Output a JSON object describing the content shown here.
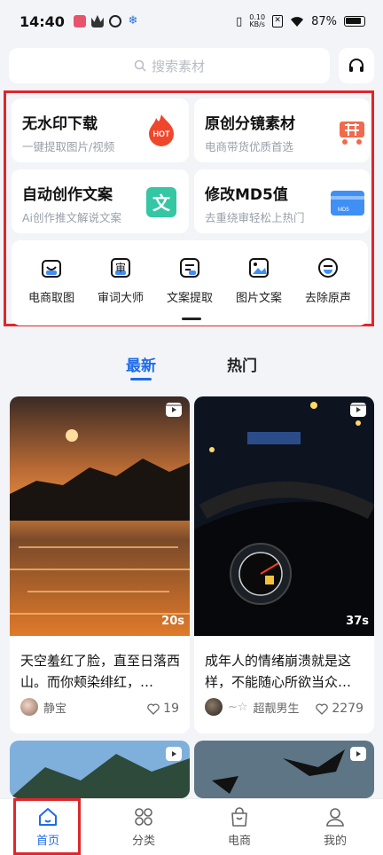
{
  "status": {
    "time": "14:40",
    "net_speed_value": "0.10",
    "net_speed_unit": "KB/s",
    "battery": "87%"
  },
  "search": {
    "placeholder": "搜索素材"
  },
  "tools": {
    "cards": [
      {
        "title": "无水印下载",
        "subtitle": "一键提取图片/视频",
        "icon": "hot-flame-icon",
        "icon_text": "HOT"
      },
      {
        "title": "原创分镜素材",
        "subtitle": "电商带货优质首选",
        "icon": "shopping-cart-icon"
      },
      {
        "title": "自动创作文案",
        "subtitle": "Ai创作推文解说文案",
        "icon": "text-icon",
        "icon_text": "文"
      },
      {
        "title": "修改MD5值",
        "subtitle": "去重绕审轻松上热门",
        "icon": "card-icon",
        "icon_text": "MD5"
      }
    ],
    "quick": [
      {
        "label": "电商取图",
        "icon": "bag-icon"
      },
      {
        "label": "审词大师",
        "icon": "audit-icon",
        "icon_text": "审"
      },
      {
        "label": "文案提取",
        "icon": "text-extract-icon"
      },
      {
        "label": "图片文案",
        "icon": "image-icon"
      },
      {
        "label": "去除原声",
        "icon": "mute-icon"
      }
    ]
  },
  "feed_tabs": [
    {
      "label": "最新",
      "active": true
    },
    {
      "label": "热门",
      "active": false
    }
  ],
  "feed": [
    {
      "caption": "天空羞红了脸，直至日落西山。而你颊染绯红，…",
      "duration": "20s",
      "author": "静宝",
      "likes": "19"
    },
    {
      "caption": "成年人的情绪崩溃就是这样，不能随心所欲当众…",
      "duration": "37s",
      "author": "超靓男生",
      "author_prefix": "~☆",
      "likes": "2279"
    }
  ],
  "bottom_nav": [
    {
      "label": "首页",
      "icon": "home-icon",
      "active": true
    },
    {
      "label": "分类",
      "icon": "grid-icon",
      "active": false
    },
    {
      "label": "电商",
      "icon": "shopping-bag-icon",
      "active": false
    },
    {
      "label": "我的",
      "icon": "user-icon",
      "active": false
    }
  ],
  "colors": {
    "accent": "#1d6ce8",
    "highlight": "#e0262b",
    "background": "#f3f4f8"
  }
}
